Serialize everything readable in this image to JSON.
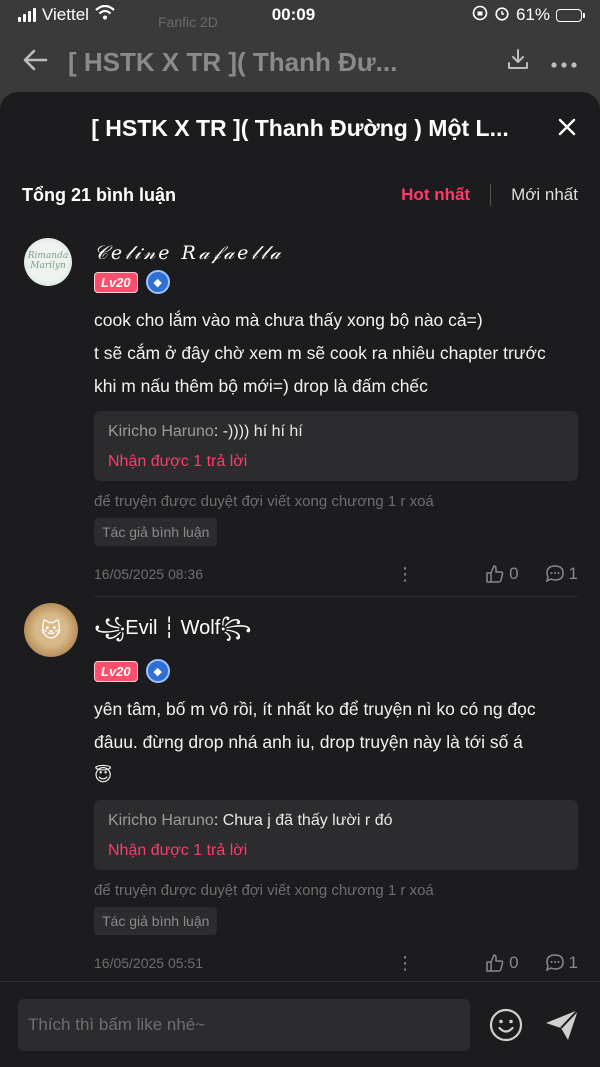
{
  "status": {
    "carrier": "Viettel",
    "time": "00:09",
    "battery": "61%",
    "battery_level": 0.61
  },
  "background": {
    "subtitle": "Fanfic 2D",
    "title": "[ HSTK X TR ]( Thanh Đư..."
  },
  "sheet": {
    "title": "[ HSTK X TR ]( Thanh Đường ) Một L...",
    "total": "Tổng 21 bình luận",
    "sort_hot": "Hot nhất",
    "sort_new": "Mới nhất"
  },
  "comments": [
    {
      "name": "𝒞𝑒𝓁𝒾𝓃𝑒 𝑅𝒶𝒻𝒶𝑒𝓁𝓁𝒶",
      "level": "Lv20",
      "avatar_text": "Rimanda Marilyn",
      "lines": [
        "cook cho lắm vào mà chưa thấy xong bộ nào cả=)",
        "t sẽ cắm ở đây chờ xem m sẽ cook ra nhiêu chapter trước",
        "khi m nấu thêm bộ mới=) drop là đấm chếc"
      ],
      "reply_name": "Kiricho Haruno",
      "reply_text": ": -)))) hí hí hí",
      "reply_count": "Nhận được 1 trả lời",
      "note": "để truyện được duyệt đợi viết xong chương 1 r xoá",
      "author_tag": "Tác giả bình luận",
      "date": "16/05/2025 08:36",
      "likes": "0",
      "replies": "1"
    },
    {
      "name": "꧁Evil ┆ Wolf꧂",
      "level": "Lv20",
      "avatar_text": "🐱",
      "lines": [
        "yên tâm, bố m vô rồi, ít nhất ko để truyện nì ko có ng đọc",
        "đâuu. đừng drop nhá anh iu, drop truyện này là tới số á",
        "😇"
      ],
      "reply_name": "Kiricho Haruno",
      "reply_text": ": Chưa j đã thấy lười r đó",
      "reply_count": "Nhận được 1 trả lời",
      "note": "để truyện được duyệt đợi viết xong chương 1 r xoá",
      "author_tag": "Tác giả bình luận",
      "date": "16/05/2025 05:51",
      "likes": "0",
      "replies": "1"
    }
  ],
  "input": {
    "placeholder": "Thích thì bấm like nhé~"
  },
  "colors": {
    "accent": "#ff3b6a",
    "sheet_bg": "#1c1c1e",
    "level_badge": "#ff4d6d"
  },
  "icons": [
    "back-arrow-icon",
    "download-icon",
    "more-icon",
    "close-icon",
    "thumbs-up-icon",
    "comment-icon",
    "emoji-icon",
    "send-icon",
    "medal-icon",
    "wifi-icon",
    "signal-icon",
    "battery-icon"
  ]
}
